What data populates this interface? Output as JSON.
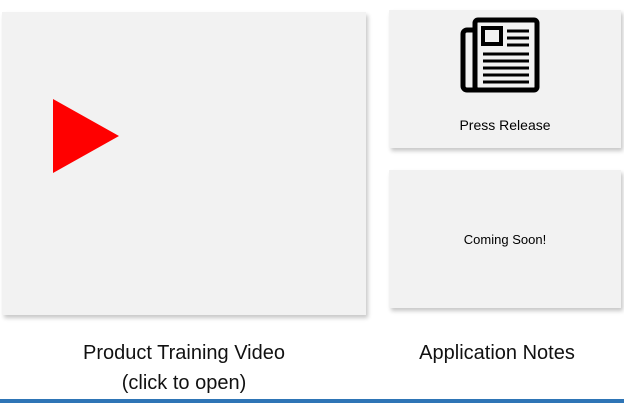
{
  "cards": {
    "video": {
      "icon": "play-icon",
      "icon_color": "#ff0000",
      "caption_line1": "Product Training Video",
      "caption_line2": "(click to open)"
    },
    "press": {
      "icon": "newspaper-icon",
      "label": "Press Release"
    },
    "notes": {
      "label": "Coming Soon!",
      "caption": "Application Notes"
    }
  },
  "colors": {
    "card_background": "#f2f2f2",
    "accent_rule": "#2e75b6",
    "play": "#ff0000"
  }
}
